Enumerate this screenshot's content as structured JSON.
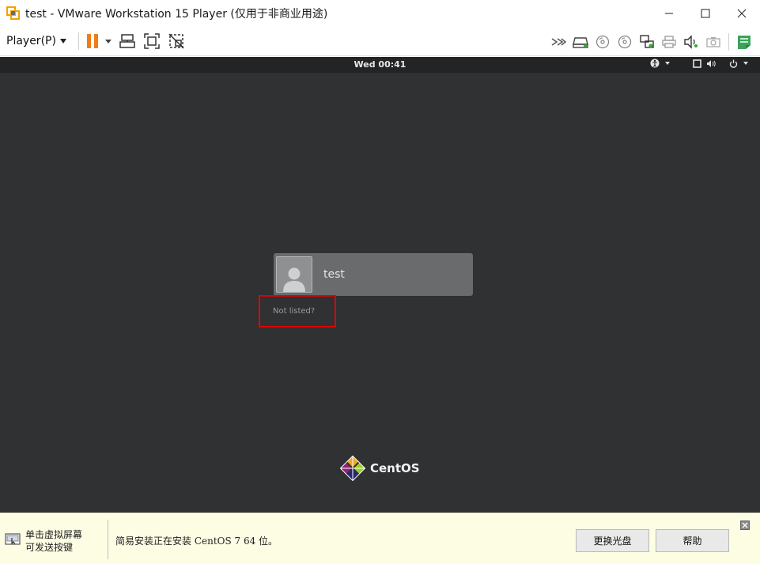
{
  "window": {
    "title": "test - VMware Workstation 15 Player (仅用于非商业用途)",
    "controls": [
      "minimize",
      "maximize",
      "close"
    ]
  },
  "toolbar": {
    "player_menu_label": "Player(P)",
    "left_icons": [
      "pause-icon",
      "dropdown-arrow-icon",
      "send-ctrl-alt-del-icon",
      "fullscreen-icon",
      "unity-icon"
    ],
    "right_icons": [
      "fast-forward-icon",
      "hard-disk-icon",
      "cd-dvd-icon",
      "cd-dvd-icon",
      "network-adapter-icon",
      "printer-icon",
      "sound-card-icon",
      "camera-icon",
      "message-log-icon"
    ]
  },
  "vm": {
    "clock": "Wed 00:41",
    "system_icons": [
      "accessibility-icon",
      "chevron-down-icon",
      "square-icon",
      "volume-icon",
      "power-icon",
      "chevron-down-icon"
    ],
    "user_name": "test",
    "not_listed_label": "Not listed?",
    "logo_text": "CentOS"
  },
  "bottombar": {
    "hint_text": "单击虚拟屏幕\n可发送按键",
    "status_text": "简易安装正在安装 CentOS 7 64 位。",
    "change_disc_button": "更换光盘",
    "help_button": "帮助"
  },
  "colors": {
    "vm_background": "#2f3133",
    "user_card": "#6a6b6c",
    "highlight": "#e10000",
    "pause_orange": "#f07d16",
    "notification_bg": "#fdfde4"
  }
}
